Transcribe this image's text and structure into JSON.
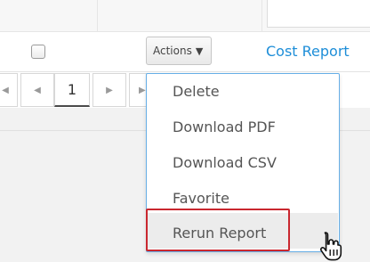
{
  "row": {
    "actions_label": "Actions",
    "report_link": "Cost Report"
  },
  "pagination": {
    "current_page": "1"
  },
  "actions_menu": {
    "items": [
      "Delete",
      "Download PDF",
      "Download CSV",
      "Favorite",
      "Rerun Report"
    ],
    "hovered_item": "Rerun Report"
  },
  "colors": {
    "link": "#1e8ed8",
    "menu_border": "#66aee6",
    "highlight": "#c9272f"
  }
}
